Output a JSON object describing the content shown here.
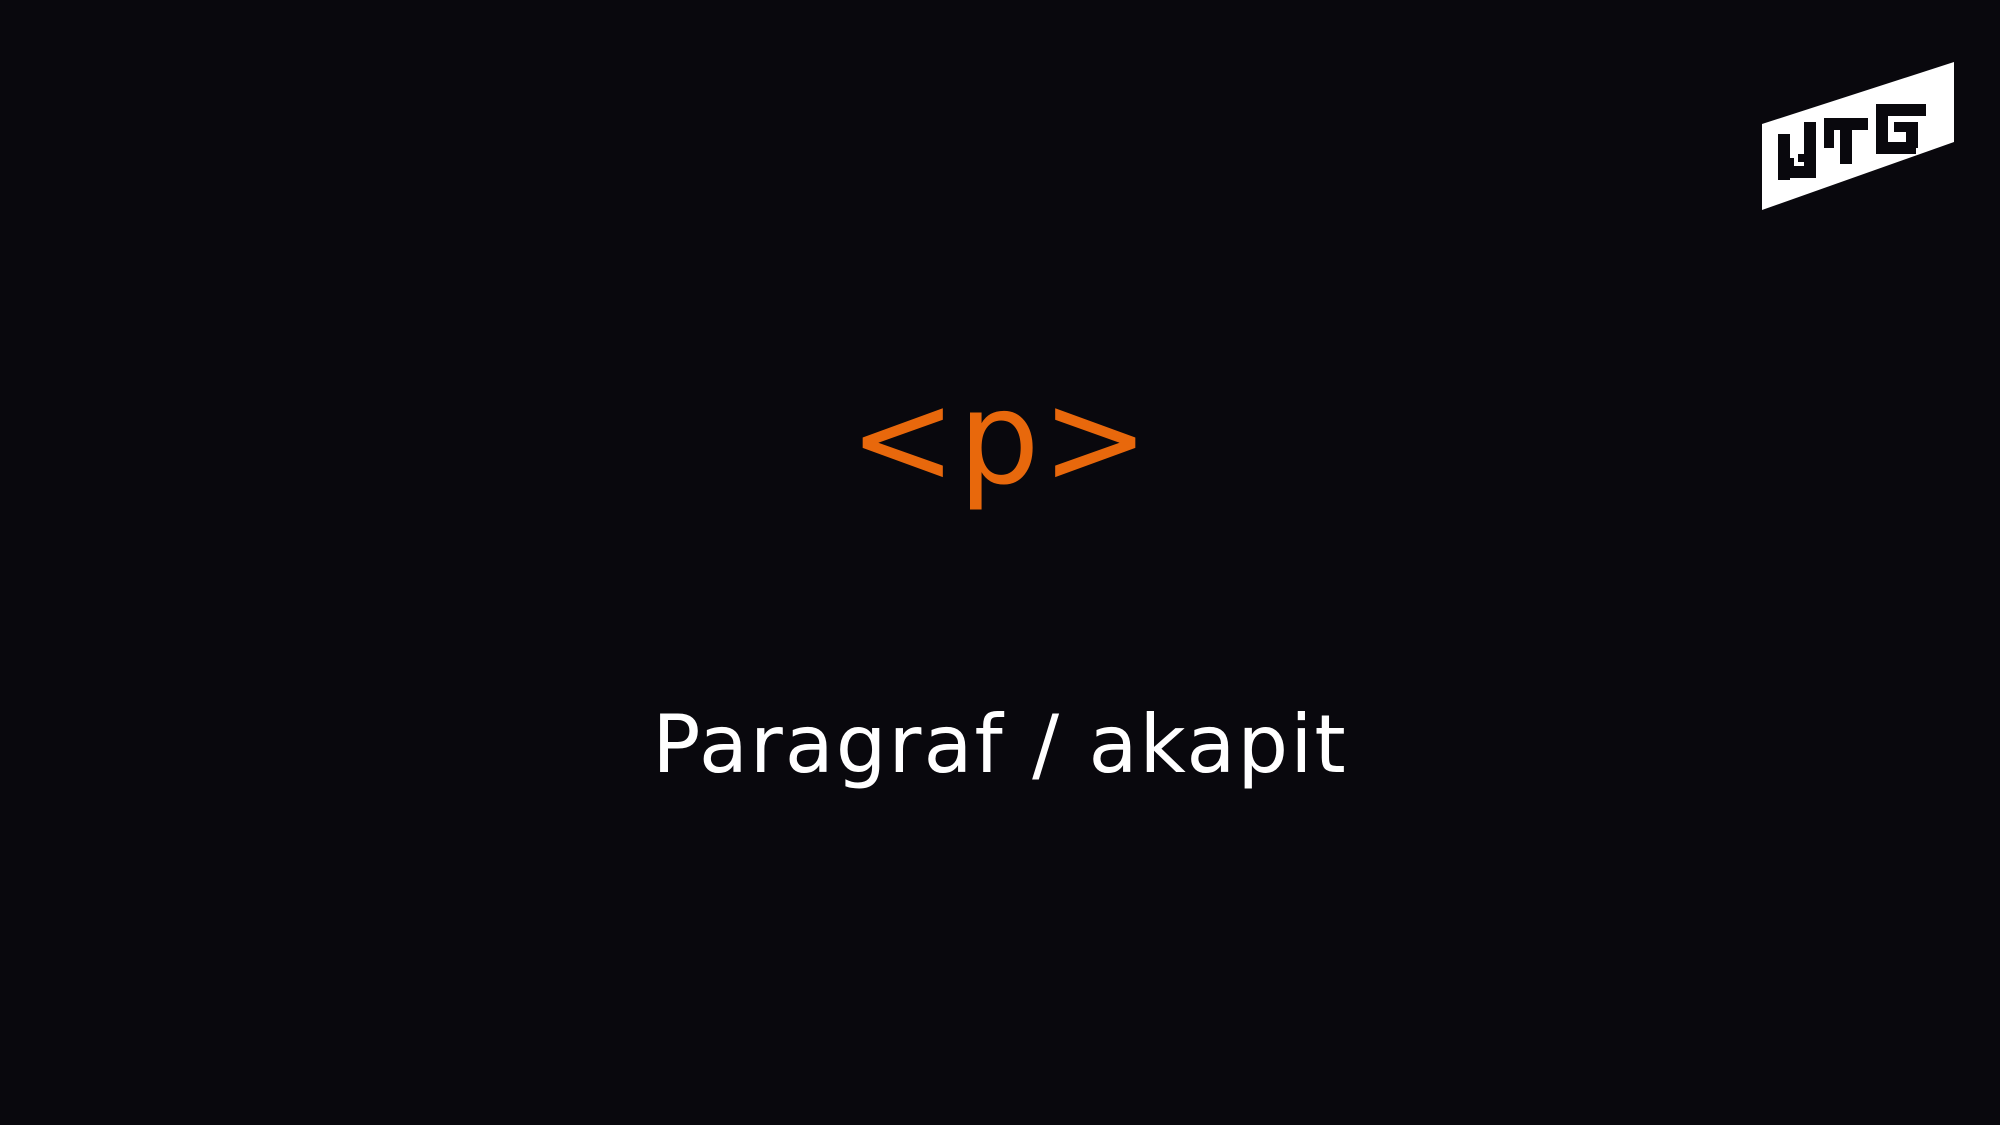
{
  "slide": {
    "tag": "<p>",
    "description": "Paragraf / akapit"
  },
  "logo": {
    "icon": "brand-logo-icon"
  },
  "colors": {
    "background": "#09080d",
    "accent": "#e8680c",
    "text": "#ffffff"
  }
}
